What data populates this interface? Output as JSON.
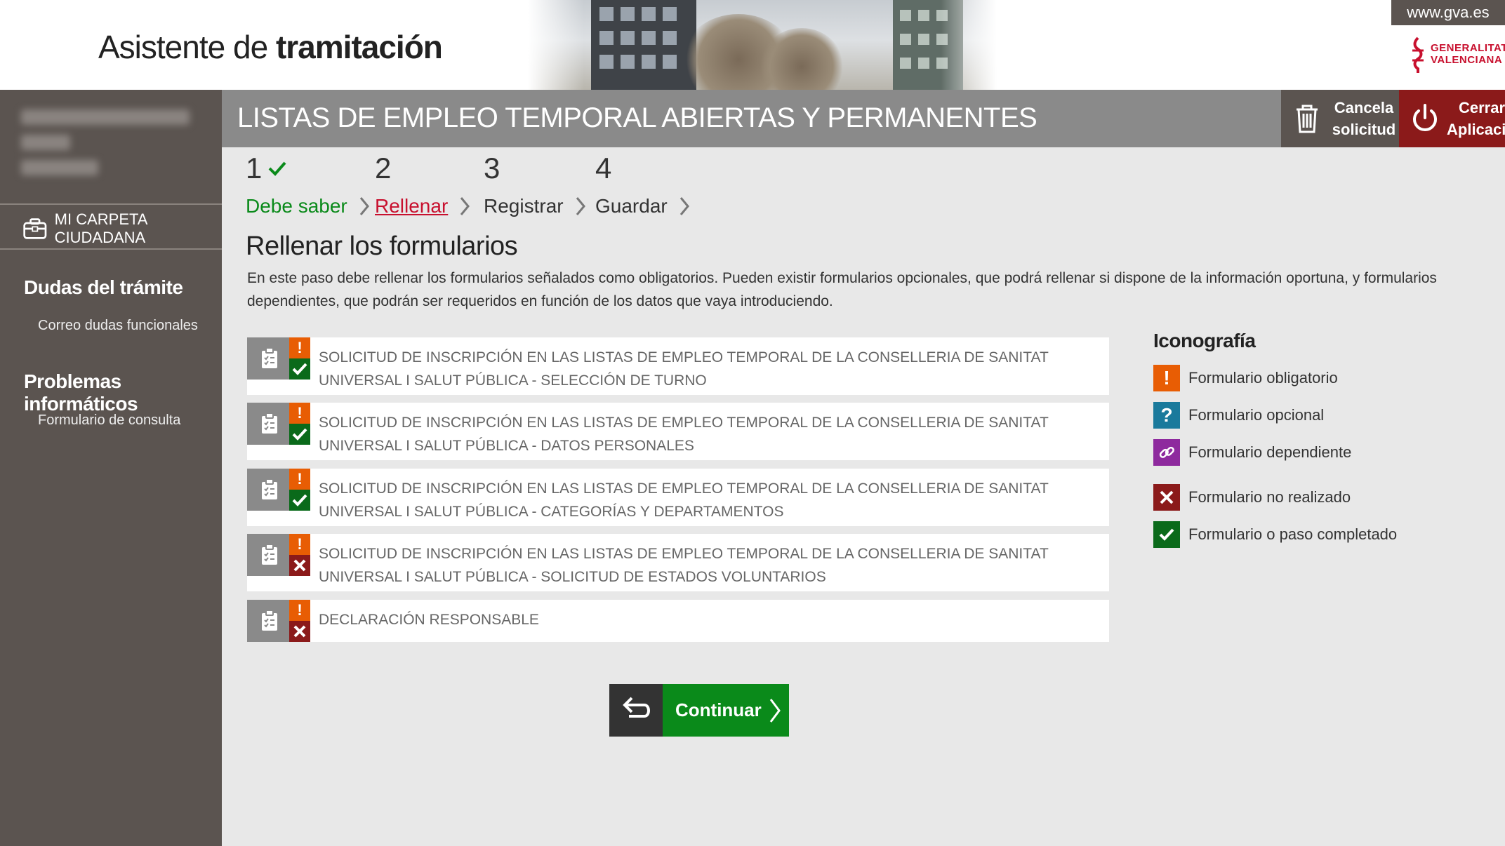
{
  "header": {
    "app_title_prefix": "Asistente de",
    "app_title_bold": "tramitación",
    "site_link": "www.gva.es",
    "logo_line1": "GENERALITAT",
    "logo_line2": "VALENCIANA"
  },
  "sidebar": {
    "carpeta_label": "MI CARPETA CIUDADANA",
    "sections": [
      {
        "heading": "Dudas del trámite",
        "link": "Correo dudas funcionales"
      },
      {
        "heading": "Problemas informáticos",
        "link": "Formulario de consulta"
      }
    ]
  },
  "titlebar": {
    "title": "LISTAS DE EMPLEO TEMPORAL ABIERTAS Y PERMANENTES",
    "cancel_line1": "Cancela",
    "cancel_line2": "solicitud",
    "close_line1": "Cerrar",
    "close_line2": "Aplicación"
  },
  "steps": [
    {
      "number": "1",
      "label": "Debe saber",
      "state": "completed"
    },
    {
      "number": "2",
      "label": "Rellenar",
      "state": "current"
    },
    {
      "number": "3",
      "label": "Registrar",
      "state": "pending"
    },
    {
      "number": "4",
      "label": "Guardar",
      "state": "pending"
    }
  ],
  "section": {
    "title": "Rellenar los formularios",
    "description": "En este paso debe rellenar los formularios señalados como obligatorios. Pueden existir formularios opcionales, que podrá rellenar si dispone de la información oportuna, y formularios dependientes, que podrán ser requeridos en función de los datos que vaya introduciendo."
  },
  "forms": [
    {
      "title": "SOLICITUD DE INSCRIPCIÓN EN LAS LISTAS DE EMPLEO TEMPORAL DE LA CONSELLERIA DE SANITAT UNIVERSAL I SALUT PÚBLICA - SELECCIÓN DE TURNO",
      "type": "obligatorio",
      "status": "completado"
    },
    {
      "title": "SOLICITUD DE INSCRIPCIÓN EN LAS LISTAS DE EMPLEO TEMPORAL DE LA CONSELLERIA DE SANITAT UNIVERSAL I SALUT PÚBLICA - DATOS PERSONALES",
      "type": "obligatorio",
      "status": "completado"
    },
    {
      "title": "SOLICITUD DE INSCRIPCIÓN EN LAS LISTAS DE EMPLEO TEMPORAL DE LA CONSELLERIA DE SANITAT UNIVERSAL I SALUT PÚBLICA - CATEGORÍAS Y DEPARTAMENTOS",
      "type": "obligatorio",
      "status": "completado"
    },
    {
      "title": "SOLICITUD DE INSCRIPCIÓN EN LAS LISTAS DE EMPLEO TEMPORAL DE LA CONSELLERIA DE SANITAT UNIVERSAL I SALUT PÚBLICA - SOLICITUD DE ESTADOS VOLUNTARIOS",
      "type": "obligatorio",
      "status": "no-realizado"
    },
    {
      "title": "DECLARACIÓN RESPONSABLE",
      "type": "obligatorio",
      "status": "no-realizado"
    }
  ],
  "legend": {
    "title": "Iconografía",
    "items": [
      {
        "label": "Formulario obligatorio",
        "icon": "exclamation-icon",
        "color": "#e85d04"
      },
      {
        "label": "Formulario opcional",
        "icon": "question-icon",
        "color": "#1a7a9c"
      },
      {
        "label": "Formulario dependiente",
        "icon": "link-icon",
        "color": "#8e2a9e"
      },
      {
        "label": "Formulario no realizado",
        "icon": "cross-icon",
        "color": "#8b1a1a"
      },
      {
        "label": "Formulario o paso completado",
        "icon": "check-icon",
        "color": "#0a6a1a"
      }
    ]
  },
  "actions": {
    "continue_label": "Continuar"
  },
  "colors": {
    "sidebar": "#5b5450",
    "titlebar": "#8a8a8a",
    "accent_green": "#0a8a1a",
    "accent_red": "#c8102e",
    "mandatory_orange": "#e85d04"
  }
}
